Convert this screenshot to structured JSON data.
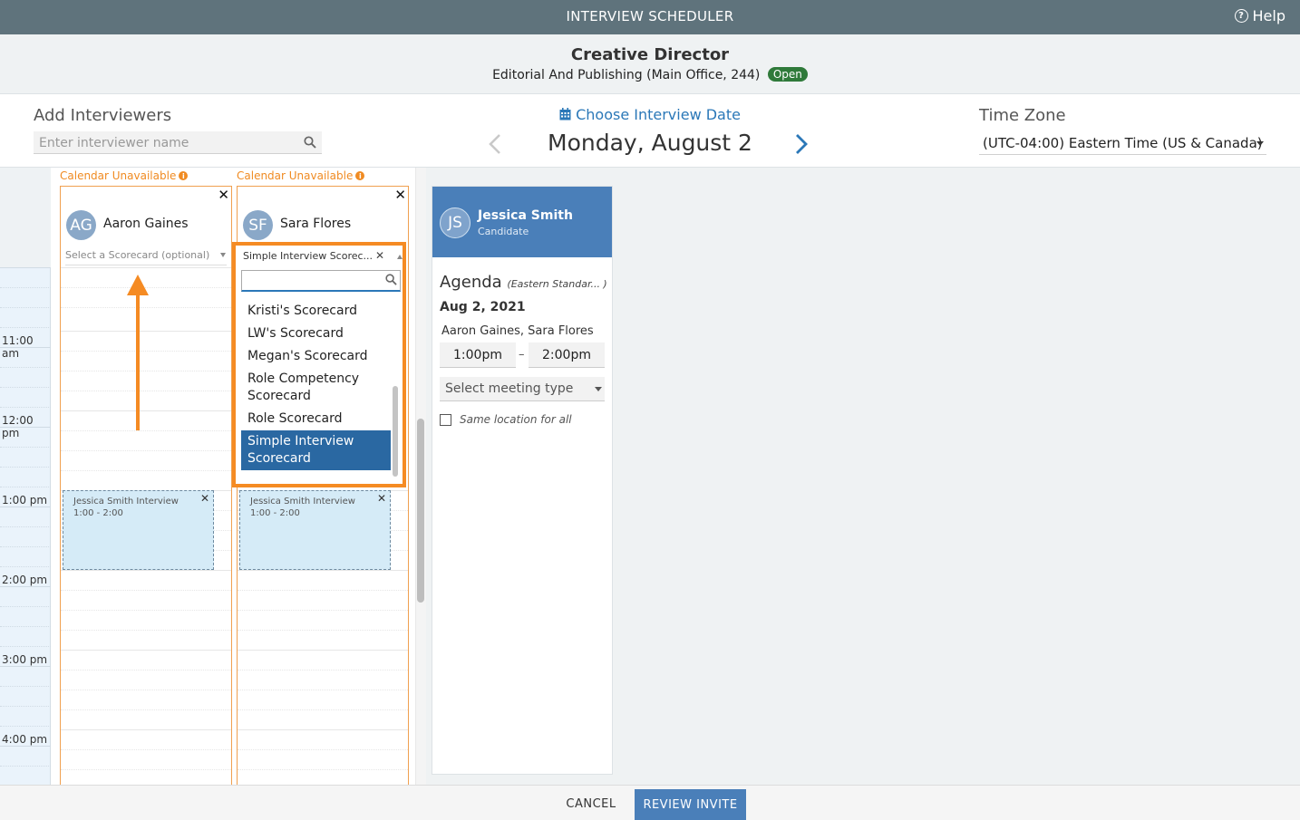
{
  "app": {
    "title": "INTERVIEW SCHEDULER",
    "help_label": "Help"
  },
  "job": {
    "title": "Creative Director",
    "subtitle": "Editorial And Publishing (Main Office, 244)",
    "status": "Open"
  },
  "interviewers_section": {
    "label": "Add Interviewers",
    "search_placeholder": "Enter interviewer name"
  },
  "date_picker": {
    "label": "Choose Interview Date",
    "current_date": "Monday, August 2"
  },
  "timezone": {
    "label": "Time Zone",
    "value": "(UTC-04:00) Eastern Time (US & Canada)"
  },
  "time_labels": [
    "11:00 am",
    "12:00 pm",
    "1:00 pm",
    "2:00 pm",
    "3:00 pm",
    "4:00 pm"
  ],
  "interviewers": [
    {
      "initials": "AG",
      "name": "Aaron Gaines",
      "calendar_status": "Calendar Unavailable",
      "scorecard_placeholder": "Select a Scorecard (optional)",
      "event_title": "Jessica Smith Interview",
      "event_time": "1:00 - 2:00"
    },
    {
      "initials": "SF",
      "name": "Sara Flores",
      "calendar_status": "Calendar Unavailable",
      "scorecard_selected": "Simple Interview Scorec...",
      "event_title": "Jessica Smith Interview",
      "event_time": "1:00 - 2:00"
    }
  ],
  "scorecard_dropdown": {
    "options": [
      "Kristi's Scorecard",
      "LW's Scorecard",
      "Megan's Scorecard",
      "Role Competency Scorecard",
      "Role Scorecard",
      "Simple Interview Scorecard"
    ],
    "active": "Simple Interview Scorecard"
  },
  "candidate": {
    "initials": "JS",
    "name": "Jessica Smith",
    "role": "Candidate"
  },
  "agenda": {
    "title": "Agenda",
    "timezone_note": "(Eastern Standar... )",
    "date": "Aug 2, 2021",
    "people": "Aaron Gaines, Sara Flores",
    "start_time": "1:00pm",
    "end_time": "2:00pm",
    "time_separator": "–",
    "meeting_type_placeholder": "Select meeting type",
    "same_location_label": "Same location for all"
  },
  "footer": {
    "cancel_label": "CANCEL",
    "review_label": "REVIEW INVITE"
  },
  "colors": {
    "topbar": "#5f737c",
    "accent_blue": "#2b78b8",
    "candidate_header": "#4a7fb9",
    "warning_orange": "#f08b22",
    "highlight_orange": "#f58b23",
    "open_badge": "#2f7a3a",
    "selected_option": "#2a68a2"
  }
}
